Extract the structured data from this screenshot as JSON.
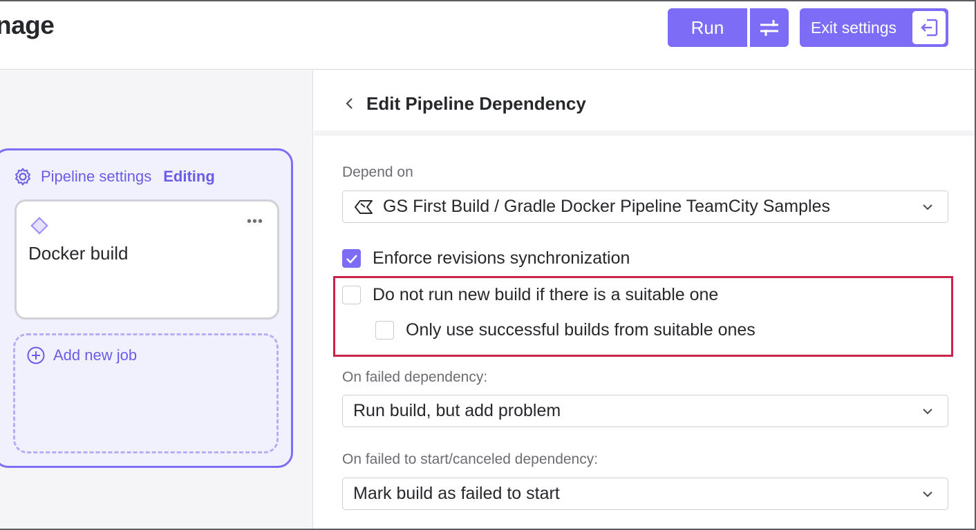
{
  "header": {
    "title": "nage",
    "run_label": "Run",
    "exit_label": "Exit settings"
  },
  "canvas": {
    "pipeline_settings_label": "Pipeline settings",
    "editing_label": "Editing",
    "job": {
      "name": "Docker build",
      "menu": "•••"
    },
    "add_job_label": "Add new job"
  },
  "panel": {
    "title": "Edit Pipeline Dependency",
    "depend_on": {
      "label": "Depend on",
      "value": "GS First Build / Gradle Docker Pipeline TeamCity Samples"
    },
    "checkboxes": [
      {
        "label": "Enforce revisions synchronization",
        "checked": true
      },
      {
        "label": "Do not run new build if there is a suitable one",
        "checked": false
      },
      {
        "label": "Only use successful builds from suitable ones",
        "checked": false
      }
    ],
    "on_failed": {
      "label": "On failed dependency:",
      "value": "Run build, but add problem"
    },
    "on_failed_start": {
      "label": "On failed to start/canceled dependency:",
      "value": "Mark build as failed to start"
    }
  },
  "colors": {
    "accent": "#7d6cf6",
    "accent_text": "#6b5ce7",
    "highlight_border": "#c9234a"
  }
}
